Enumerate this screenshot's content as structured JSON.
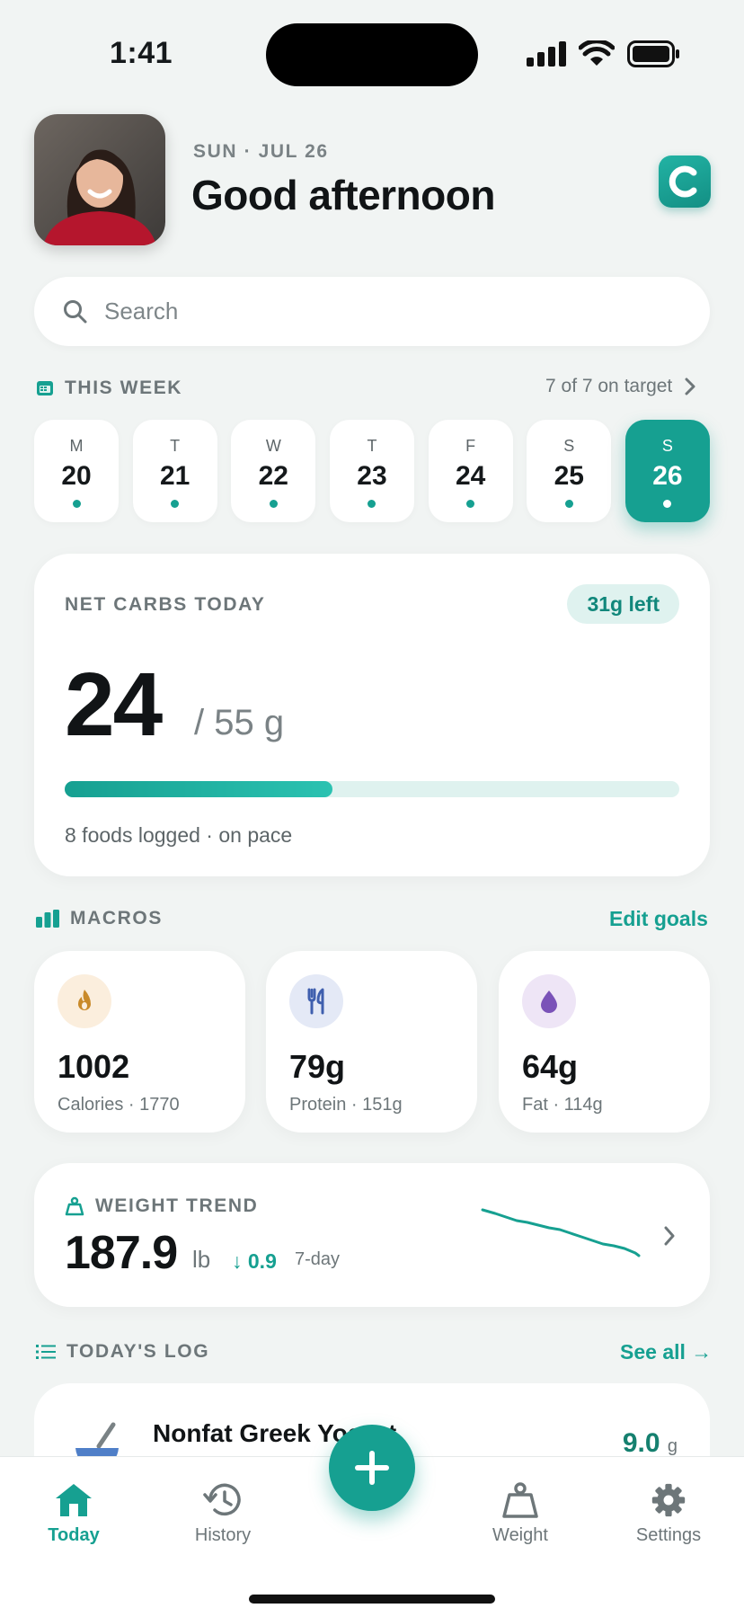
{
  "status": {
    "time": "1:41"
  },
  "header": {
    "date": "SUN · JUL 26",
    "greeting": "Good afternoon"
  },
  "search": {
    "placeholder": "Search"
  },
  "week": {
    "label": "THIS WEEK",
    "target_text": "7 of 7 on target",
    "days": [
      {
        "letter": "M",
        "num": "20"
      },
      {
        "letter": "T",
        "num": "21"
      },
      {
        "letter": "W",
        "num": "22"
      },
      {
        "letter": "T",
        "num": "23"
      },
      {
        "letter": "F",
        "num": "24"
      },
      {
        "letter": "S",
        "num": "25"
      },
      {
        "letter": "S",
        "num": "26"
      }
    ]
  },
  "carbs": {
    "label": "NET CARBS TODAY",
    "left": "31g left",
    "value": "24",
    "goal": "/ 55 g",
    "progress": 0.436,
    "sub": "8 foods logged · on pace"
  },
  "macros": {
    "label": "MACROS",
    "edit": "Edit goals",
    "items": [
      {
        "value": "1002",
        "sub": "Calories · 1770",
        "icon": "flame-icon",
        "color": "#c98a2a",
        "bg": "#fbeedd"
      },
      {
        "value": "79g",
        "sub": "Protein · 151g",
        "icon": "fork-knife-icon",
        "color": "#3f5fae",
        "bg": "#e4e9f6"
      },
      {
        "value": "64g",
        "sub": "Fat · 114g",
        "icon": "drop-icon",
        "color": "#7a52b8",
        "bg": "#eee5f6"
      }
    ]
  },
  "weight": {
    "label": "WEIGHT TREND",
    "value": "187.9",
    "unit": "lb",
    "delta": "↓ 0.9",
    "period": "7-day"
  },
  "log": {
    "label": "TODAY'S LOG",
    "see_all": "See all →",
    "items": [
      {
        "name": "Nonfat Greek Yogurt",
        "qty": "9.0",
        "unit": "g"
      }
    ]
  },
  "tabs": [
    "Today",
    "History",
    "Weight",
    "Settings"
  ],
  "colors": {
    "accent": "#16a091"
  }
}
